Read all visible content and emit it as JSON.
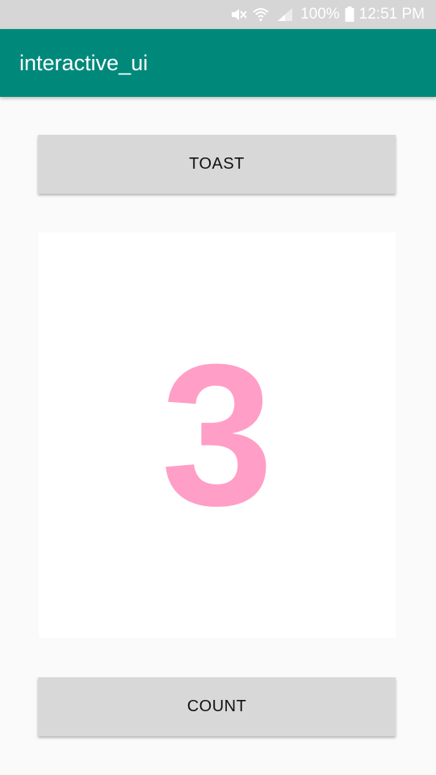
{
  "status_bar": {
    "battery_percent": "100%",
    "time": "12:51 PM",
    "icons": [
      "mute-icon",
      "wifi-icon",
      "signal-icon",
      "battery-icon"
    ]
  },
  "app_bar": {
    "title": "interactive_ui",
    "color": "#00897b"
  },
  "toast_button": {
    "label": "TOAST"
  },
  "counter": {
    "value": "3",
    "color": "#ff9ec6"
  },
  "count_button": {
    "label": "COUNT"
  }
}
